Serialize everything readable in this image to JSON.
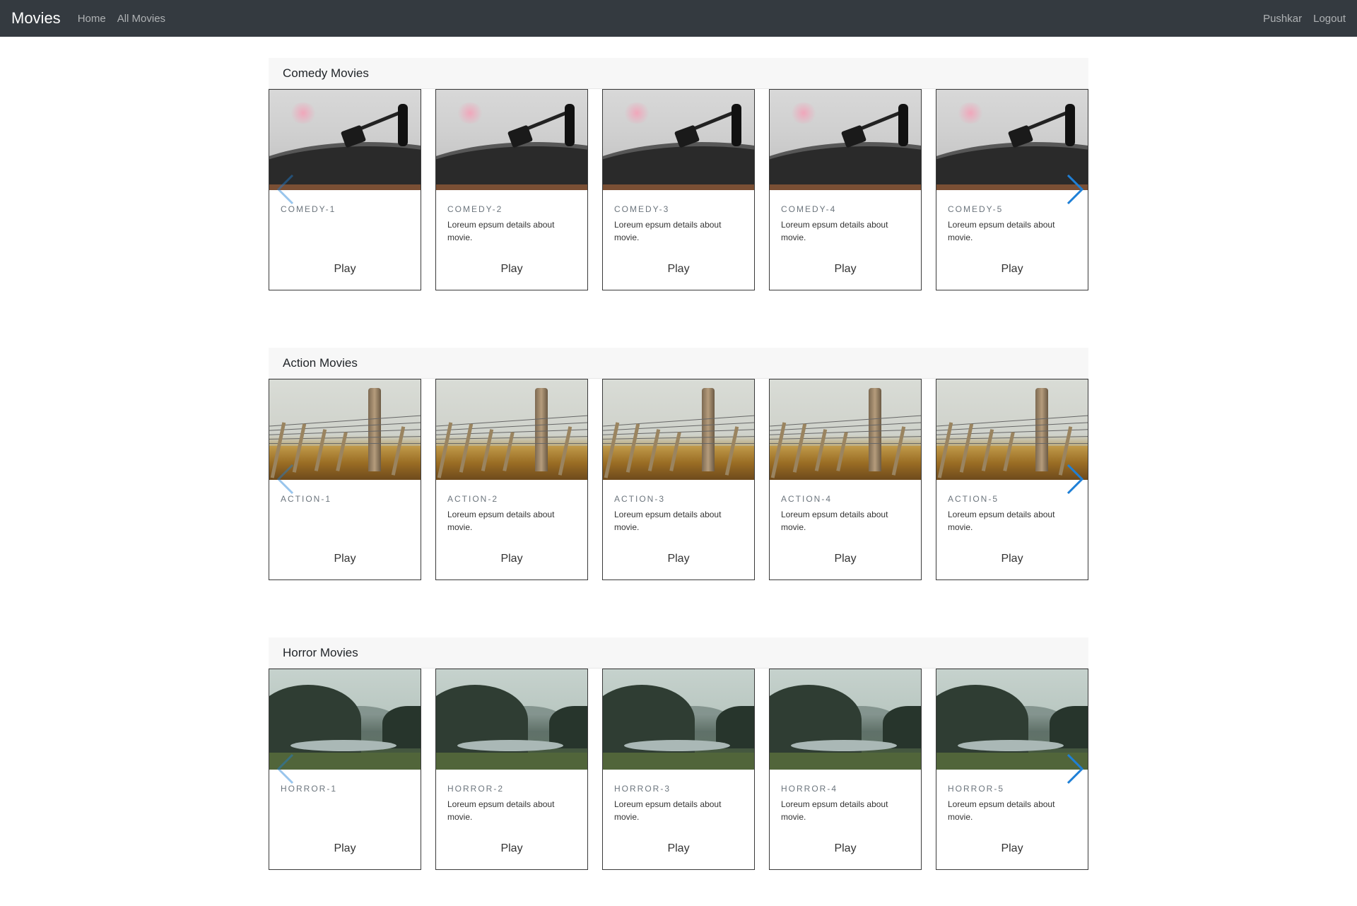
{
  "navbar": {
    "brand": "Movies",
    "links": [
      "Home",
      "All Movies"
    ],
    "user": "Pushkar",
    "logout": "Logout"
  },
  "sections": [
    {
      "title": "Comedy Movies",
      "image": "record-player",
      "cards": [
        {
          "title": "COMEDY-1",
          "desc": "",
          "play": "Play"
        },
        {
          "title": "COMEDY-2",
          "desc": "Loreum epsum details about movie.",
          "play": "Play"
        },
        {
          "title": "COMEDY-3",
          "desc": "Loreum epsum details about movie.",
          "play": "Play"
        },
        {
          "title": "COMEDY-4",
          "desc": "Loreum epsum details about movie.",
          "play": "Play"
        },
        {
          "title": "COMEDY-5",
          "desc": "Loreum epsum details about movie.",
          "play": "Play"
        }
      ]
    },
    {
      "title": "Action Movies",
      "image": "fence",
      "cards": [
        {
          "title": "ACTION-1",
          "desc": "",
          "play": "Play"
        },
        {
          "title": "ACTION-2",
          "desc": "Loreum epsum details about movie.",
          "play": "Play"
        },
        {
          "title": "ACTION-3",
          "desc": "Loreum epsum details about movie.",
          "play": "Play"
        },
        {
          "title": "ACTION-4",
          "desc": "Loreum epsum details about movie.",
          "play": "Play"
        },
        {
          "title": "ACTION-5",
          "desc": "Loreum epsum details about movie.",
          "play": "Play"
        }
      ]
    },
    {
      "title": "Horror Movies",
      "image": "forest",
      "cards": [
        {
          "title": "HORROR-1",
          "desc": "",
          "play": "Play"
        },
        {
          "title": "HORROR-2",
          "desc": "Loreum epsum details about movie.",
          "play": "Play"
        },
        {
          "title": "HORROR-3",
          "desc": "Loreum epsum details about movie.",
          "play": "Play"
        },
        {
          "title": "HORROR-4",
          "desc": "Loreum epsum details about movie.",
          "play": "Play"
        },
        {
          "title": "HORROR-5",
          "desc": "Loreum epsum details about movie.",
          "play": "Play"
        }
      ]
    }
  ],
  "icons": {
    "prev": "chevron-left-icon",
    "next": "chevron-right-icon"
  },
  "colors": {
    "navbar": "#343a40",
    "arrow": "#1e7fd6",
    "section_header": "#f7f7f7"
  }
}
